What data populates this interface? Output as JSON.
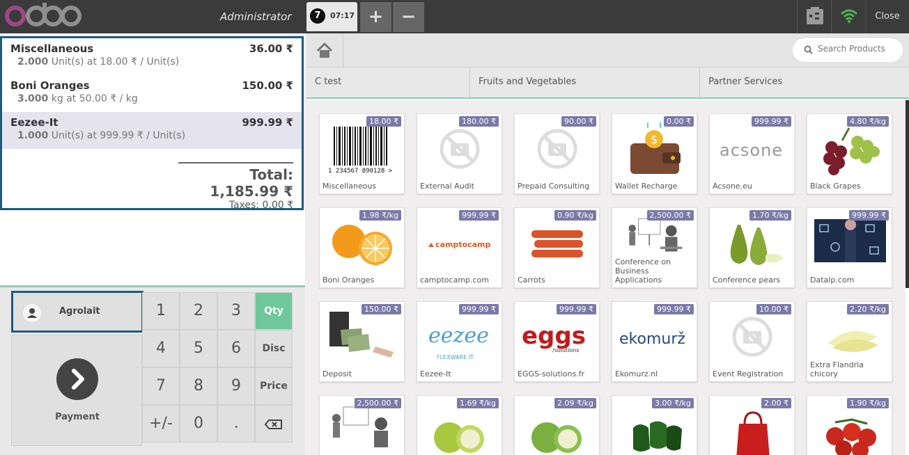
{
  "header": {
    "logo": "odoo",
    "user": "Administrator",
    "order_number": "7",
    "order_time": "07:17",
    "add_label": "+",
    "remove_label": "−",
    "close_label": "Close"
  },
  "order": {
    "lines": [
      {
        "name": "Miscellaneous",
        "price": "36.00 ₹",
        "qty": "2.000",
        "detail": " Unit(s) at 18.00 ₹ / Unit(s)"
      },
      {
        "name": "Boni Oranges",
        "price": "150.00 ₹",
        "qty": "3.000",
        "detail": " kg at 50.00 ₹ / kg"
      },
      {
        "name": "Eezee-It",
        "price": "999.99 ₹",
        "qty": "1.000",
        "detail": " Unit(s) at 999.99 ₹ / Unit(s)"
      }
    ],
    "total": "Total: 1,185.99 ₹",
    "taxes": "Taxes: 0.00 ₹"
  },
  "customer": {
    "label": "Agrolait"
  },
  "payment": {
    "label": "Payment",
    "icon": "chevron-right-icon"
  },
  "numpad": {
    "k1": "1",
    "k2": "2",
    "k3": "3",
    "k4": "4",
    "k5": "5",
    "k6": "6",
    "k7": "7",
    "k8": "8",
    "k9": "9",
    "kpm": "+/-",
    "k0": "0",
    "kdot": ".",
    "qty": "Qty",
    "disc": "Disc",
    "price": "Price"
  },
  "search": {
    "placeholder": "Search Products"
  },
  "categories": [
    "C test",
    "Fruits and Vegetables",
    "Partner Services"
  ],
  "products": [
    {
      "name": "Miscellaneous",
      "price": "18.00 ₹"
    },
    {
      "name": "External Audit",
      "price": "180.00 ₹"
    },
    {
      "name": "Prepaid Consulting",
      "price": "90.00 ₹"
    },
    {
      "name": "Wallet Recharge",
      "price": "0.00 ₹"
    },
    {
      "name": "Acsone.eu",
      "price": "999.99 ₹"
    },
    {
      "name": "Black Grapes",
      "price": "4.80 ₹/kg"
    },
    {
      "name": "Boni Oranges",
      "price": "1.98 ₹/kg"
    },
    {
      "name": "camptocamp.com",
      "price": "999.99 ₹"
    },
    {
      "name": "Carrots",
      "price": "0.90 ₹/kg"
    },
    {
      "name": "Conference on Business Applications",
      "price": "2,500.00 ₹"
    },
    {
      "name": "Conference pears",
      "price": "1.70 ₹/kg"
    },
    {
      "name": "Datalp.com",
      "price": "999.99 ₹"
    },
    {
      "name": "Deposit",
      "price": "150.00 ₹"
    },
    {
      "name": "Eezee-It",
      "price": "999.99 ₹"
    },
    {
      "name": "EGGS-solutions.fr",
      "price": "999.99 ₹"
    },
    {
      "name": "Ekomurz.nl",
      "price": "999.99 ₹"
    },
    {
      "name": "Event Registration",
      "price": "10.00 ₹"
    },
    {
      "name": "Extra Flandria chicory",
      "price": "2.20 ₹/kg"
    },
    {
      "name": "",
      "price": "2,500.00 ₹"
    },
    {
      "name": "",
      "price": "1.69 ₹/kg"
    },
    {
      "name": "",
      "price": "2.09 ₹/kg"
    },
    {
      "name": "",
      "price": "3.00 ₹/kg"
    },
    {
      "name": "",
      "price": "2.00 ₹"
    },
    {
      "name": "",
      "price": "1.90 ₹/kg"
    }
  ],
  "logos": {
    "acsone": "acsone",
    "camptocamp": "camptocamp",
    "eezee": "eezee",
    "eezee_sub": "FLEXWARE IT.",
    "eggs": "eggs",
    "eggs_sub": "/solutions",
    "ekomurz": "ekomurž",
    "barcode_digits": "1 234567 890128 >"
  },
  "colors": {
    "accent": "#6ec89b",
    "header": "#3b3b3b",
    "selection_border": "#1f5b7a",
    "price_tag": "#7a7aa8"
  }
}
